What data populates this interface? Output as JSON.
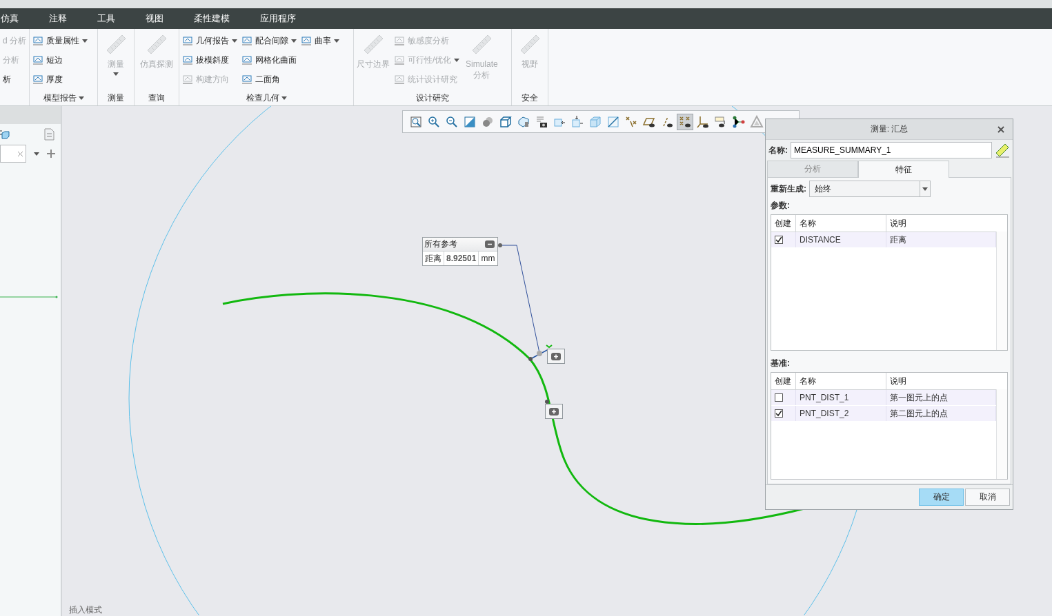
{
  "menu": {
    "tabs": [
      {
        "label": "仿真"
      },
      {
        "label": "注释"
      },
      {
        "label": "工具"
      },
      {
        "label": "视图"
      },
      {
        "label": "柔性建模"
      },
      {
        "label": "应用程序"
      }
    ]
  },
  "ribbon": {
    "groups": [
      {
        "columns": [
          [
            {
              "label": "d 分析",
              "kind": "small",
              "disabled": true,
              "menu": false
            },
            {
              "label": "分析",
              "kind": "small",
              "disabled": true,
              "menu": false
            },
            {
              "label": "析",
              "kind": "small",
              "disabled": false,
              "menu": false
            }
          ]
        ]
      },
      {
        "label": "模型报告",
        "menu": true,
        "columns": [
          [
            {
              "label": "质量属性",
              "kind": "small",
              "disabled": false,
              "menu": true
            },
            {
              "label": "短边",
              "kind": "small",
              "disabled": false,
              "menu": false
            },
            {
              "label": "厚度",
              "kind": "small",
              "disabled": false,
              "menu": false
            }
          ]
        ]
      },
      {
        "label": "测量",
        "menu": false,
        "columns": [
          [
            {
              "label": "测量",
              "kind": "large",
              "disabled": true,
              "menu": true
            }
          ]
        ]
      },
      {
        "label": "查询",
        "menu": false,
        "columns": [
          [
            {
              "label": "仿真探测",
              "kind": "large",
              "disabled": true,
              "menu": false
            }
          ]
        ]
      },
      {
        "label": "检查几何",
        "menu": true,
        "columns": [
          [
            {
              "label": "几何报告",
              "kind": "small",
              "disabled": false,
              "menu": true
            },
            {
              "label": "拔模斜度",
              "kind": "small",
              "disabled": false,
              "menu": false
            },
            {
              "label": "构建方向",
              "kind": "small",
              "disabled": true,
              "menu": false
            }
          ],
          [
            {
              "label": "配合间隙",
              "kind": "small",
              "disabled": false,
              "menu": true
            },
            {
              "label": "网格化曲面",
              "kind": "small",
              "disabled": false,
              "menu": false
            },
            {
              "label": "二面角",
              "kind": "small",
              "disabled": false,
              "menu": false
            }
          ],
          [
            {
              "label": "曲率",
              "kind": "small",
              "disabled": false,
              "menu": true
            }
          ]
        ]
      },
      {
        "label": "设计研究",
        "menu": false,
        "columns": [
          [
            {
              "label": "尺寸边界",
              "kind": "large",
              "disabled": true,
              "menu": false
            }
          ],
          [
            {
              "label": "敏感度分析",
              "kind": "small",
              "disabled": true,
              "menu": false
            },
            {
              "label": "可行性/优化",
              "kind": "small",
              "disabled": true,
              "menu": true
            },
            {
              "label": "统计设计研究",
              "kind": "small",
              "disabled": true,
              "menu": false
            }
          ],
          [
            {
              "label": "Simulate 分析",
              "kind": "large",
              "disabled": true,
              "menu": false
            }
          ]
        ]
      },
      {
        "label": "安全",
        "menu": false,
        "columns": [
          [
            {
              "label": "视野",
              "kind": "large",
              "disabled": true,
              "menu": false
            }
          ]
        ]
      }
    ]
  },
  "toolbar": {
    "buttons": [
      {
        "selected": false
      },
      {
        "selected": false
      },
      {
        "selected": false
      },
      {
        "selected": false
      },
      {
        "selected": false
      },
      {
        "selected": false
      },
      {
        "selected": false
      },
      {
        "selected": false
      },
      {
        "selected": false
      },
      {
        "selected": false
      },
      {
        "selected": false
      },
      {
        "selected": false
      },
      {
        "selected": false
      },
      {
        "selected": false
      },
      {
        "selected": false
      },
      {
        "selected": true
      },
      {
        "selected": false
      },
      {
        "selected": false
      },
      {
        "selected": false
      },
      {
        "selected": false
      }
    ]
  },
  "annotation": {
    "title": "所有参考",
    "label": "距离",
    "value": "8.92501",
    "unit": "mm"
  },
  "dialog": {
    "title": "测量: 汇总",
    "name_label": "名称:",
    "name_value": "MEASURE_SUMMARY_1",
    "tabs": [
      {
        "label": "分析",
        "selected": false
      },
      {
        "label": "特征",
        "selected": true
      }
    ],
    "regen_label": "重新生成:",
    "regen_value": "始终",
    "params": {
      "label": "参数:",
      "columns": [
        "创建",
        "名称",
        "说明"
      ],
      "rows": [
        {
          "checked": true,
          "name": "DISTANCE",
          "description": "距离"
        }
      ]
    },
    "datums": {
      "label": "基准:",
      "columns": [
        "创建",
        "名称",
        "说明"
      ],
      "rows": [
        {
          "checked": false,
          "name": "PNT_DIST_1",
          "description": "第一图元上的点"
        },
        {
          "checked": true,
          "name": "PNT_DIST_2",
          "description": "第二图元上的点"
        }
      ]
    },
    "buttons": [
      {
        "label": "确定",
        "primary": true
      },
      {
        "label": "取消",
        "primary": false
      }
    ]
  },
  "status_text": "插入模式"
}
